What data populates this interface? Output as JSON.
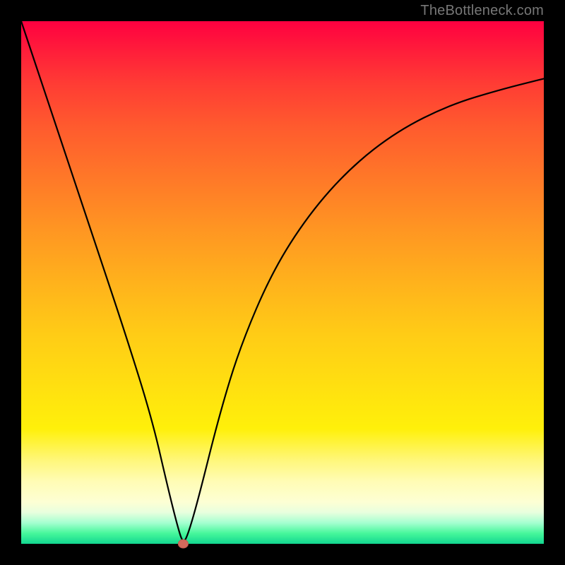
{
  "watermark": "TheBottleneck.com",
  "colors": {
    "gradient_top": "#ff0040",
    "gradient_bottom": "#12d790",
    "curve": "#000000",
    "dot": "#d46a5c",
    "background": "#000000"
  },
  "chart_data": {
    "type": "line",
    "title": "",
    "xlabel": "",
    "ylabel": "",
    "xlim": [
      0,
      100
    ],
    "ylim": [
      0,
      100
    ],
    "annotations": [
      {
        "name": "minimum-dot",
        "x": 31,
        "y": 0
      }
    ],
    "series": [
      {
        "name": "bottleneck-curve",
        "x": [
          0,
          5,
          10,
          15,
          20,
          25,
          28,
          30,
          31,
          32,
          34,
          38,
          42,
          48,
          55,
          63,
          72,
          82,
          92,
          100
        ],
        "values": [
          100,
          85,
          70,
          55,
          40,
          24,
          11,
          3,
          0,
          2,
          9,
          25,
          38,
          52,
          63,
          72,
          79,
          84,
          87,
          89
        ]
      }
    ]
  }
}
